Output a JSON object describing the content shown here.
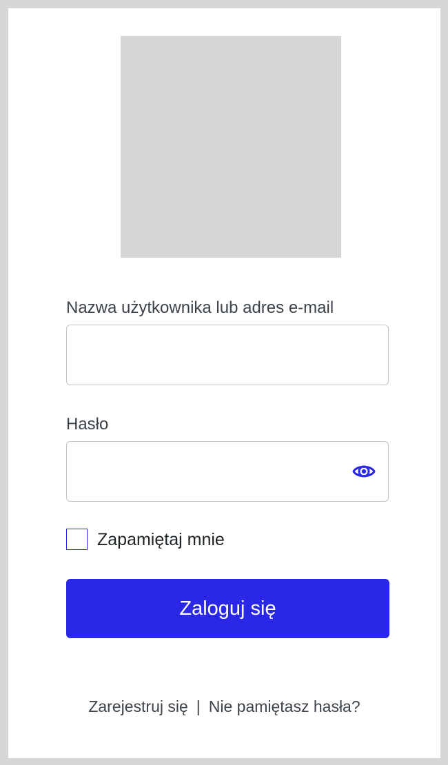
{
  "login_form": {
    "username_label": "Nazwa użytkownika lub adres e-mail",
    "username_value": "",
    "password_label": "Hasło",
    "password_value": "",
    "show_password_icon": "eye-icon",
    "remember_me_label": "Zapamiętaj mnie",
    "remember_me_checked": false,
    "submit_label": "Zaloguj się"
  },
  "footer_links": {
    "register": "Zarejestruj się",
    "separator": "|",
    "lost_password": "Nie pamiętasz hasła?"
  },
  "colors": {
    "accent": "#2a28e6",
    "page_background": "#d6d6d6",
    "card_background": "#ffffff",
    "logo_placeholder": "#d6d6d6",
    "text": "#3c434a",
    "input_border": "#c3c4c7"
  }
}
